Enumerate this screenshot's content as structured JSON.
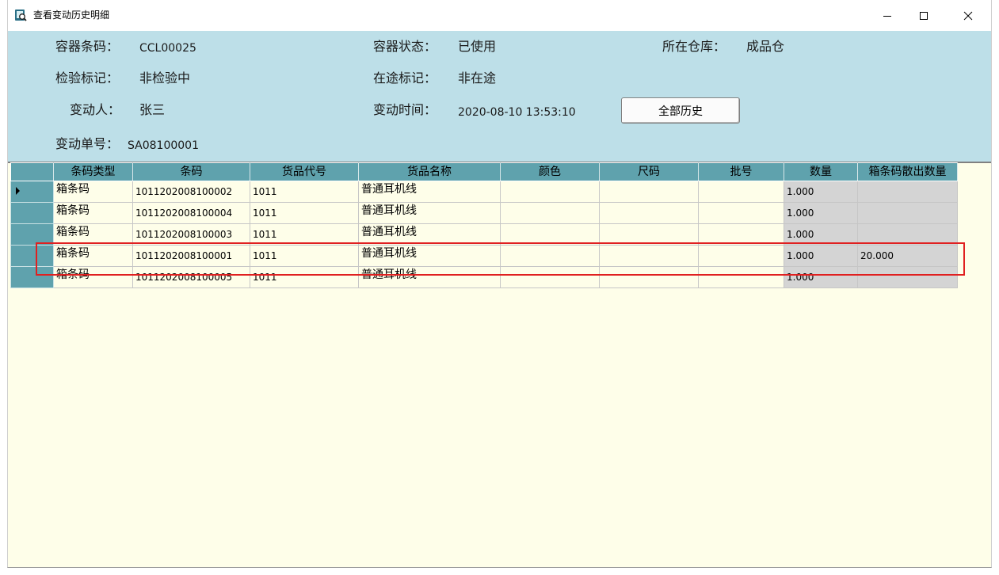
{
  "window": {
    "title": "查看变动历史明细",
    "icon": "document-search-icon",
    "controls": {
      "minimize": "minimize-icon",
      "maximize": "maximize-icon",
      "close": "close-icon"
    }
  },
  "info": {
    "container_code_label": "容器条码：",
    "container_code": "CCL00025",
    "container_status_label": "容器状态：",
    "container_status": "已使用",
    "warehouse_label": "所在仓库：",
    "warehouse": "成品仓",
    "inspection_label": "检验标记：",
    "inspection": "非检验中",
    "transit_label": "在途标记：",
    "transit": "非在途",
    "changer_label": "变动人：",
    "changer": "张三",
    "change_time_label": "变动时间：",
    "change_time": "2020-08-10 13:53:10",
    "history_button": "全部历史",
    "change_no_label": "变动单号：",
    "change_no": "SA08100001"
  },
  "grid": {
    "columns": [
      "条码类型",
      "条码",
      "货品代号",
      "货品名称",
      "颜色",
      "尺码",
      "批号",
      "数量",
      "箱条码散出数量"
    ],
    "rows": [
      {
        "type": "箱条码",
        "barcode": "1011202008100002",
        "code": "1011",
        "name": "普通耳机线",
        "color": "",
        "size": "",
        "batch": "",
        "qty": "1.000",
        "loose_qty": ""
      },
      {
        "type": "箱条码",
        "barcode": "1011202008100004",
        "code": "1011",
        "name": "普通耳机线",
        "color": "",
        "size": "",
        "batch": "",
        "qty": "1.000",
        "loose_qty": ""
      },
      {
        "type": "箱条码",
        "barcode": "1011202008100003",
        "code": "1011",
        "name": "普通耳机线",
        "color": "",
        "size": "",
        "batch": "",
        "qty": "1.000",
        "loose_qty": ""
      },
      {
        "type": "箱条码",
        "barcode": "1011202008100001",
        "code": "1011",
        "name": "普通耳机线",
        "color": "",
        "size": "",
        "batch": "",
        "qty": "1.000",
        "loose_qty": "20.000"
      },
      {
        "type": "箱条码",
        "barcode": "1011202008100005",
        "code": "1011",
        "name": "普通耳机线",
        "color": "",
        "size": "",
        "batch": "",
        "qty": "1.000",
        "loose_qty": ""
      }
    ]
  },
  "colors": {
    "info_panel": "#bddfe8",
    "grid_header": "#5fa2ad",
    "grid_body": "#fefee9",
    "readonly_cell": "#d4d4d4",
    "highlight_box": "#e02020"
  }
}
